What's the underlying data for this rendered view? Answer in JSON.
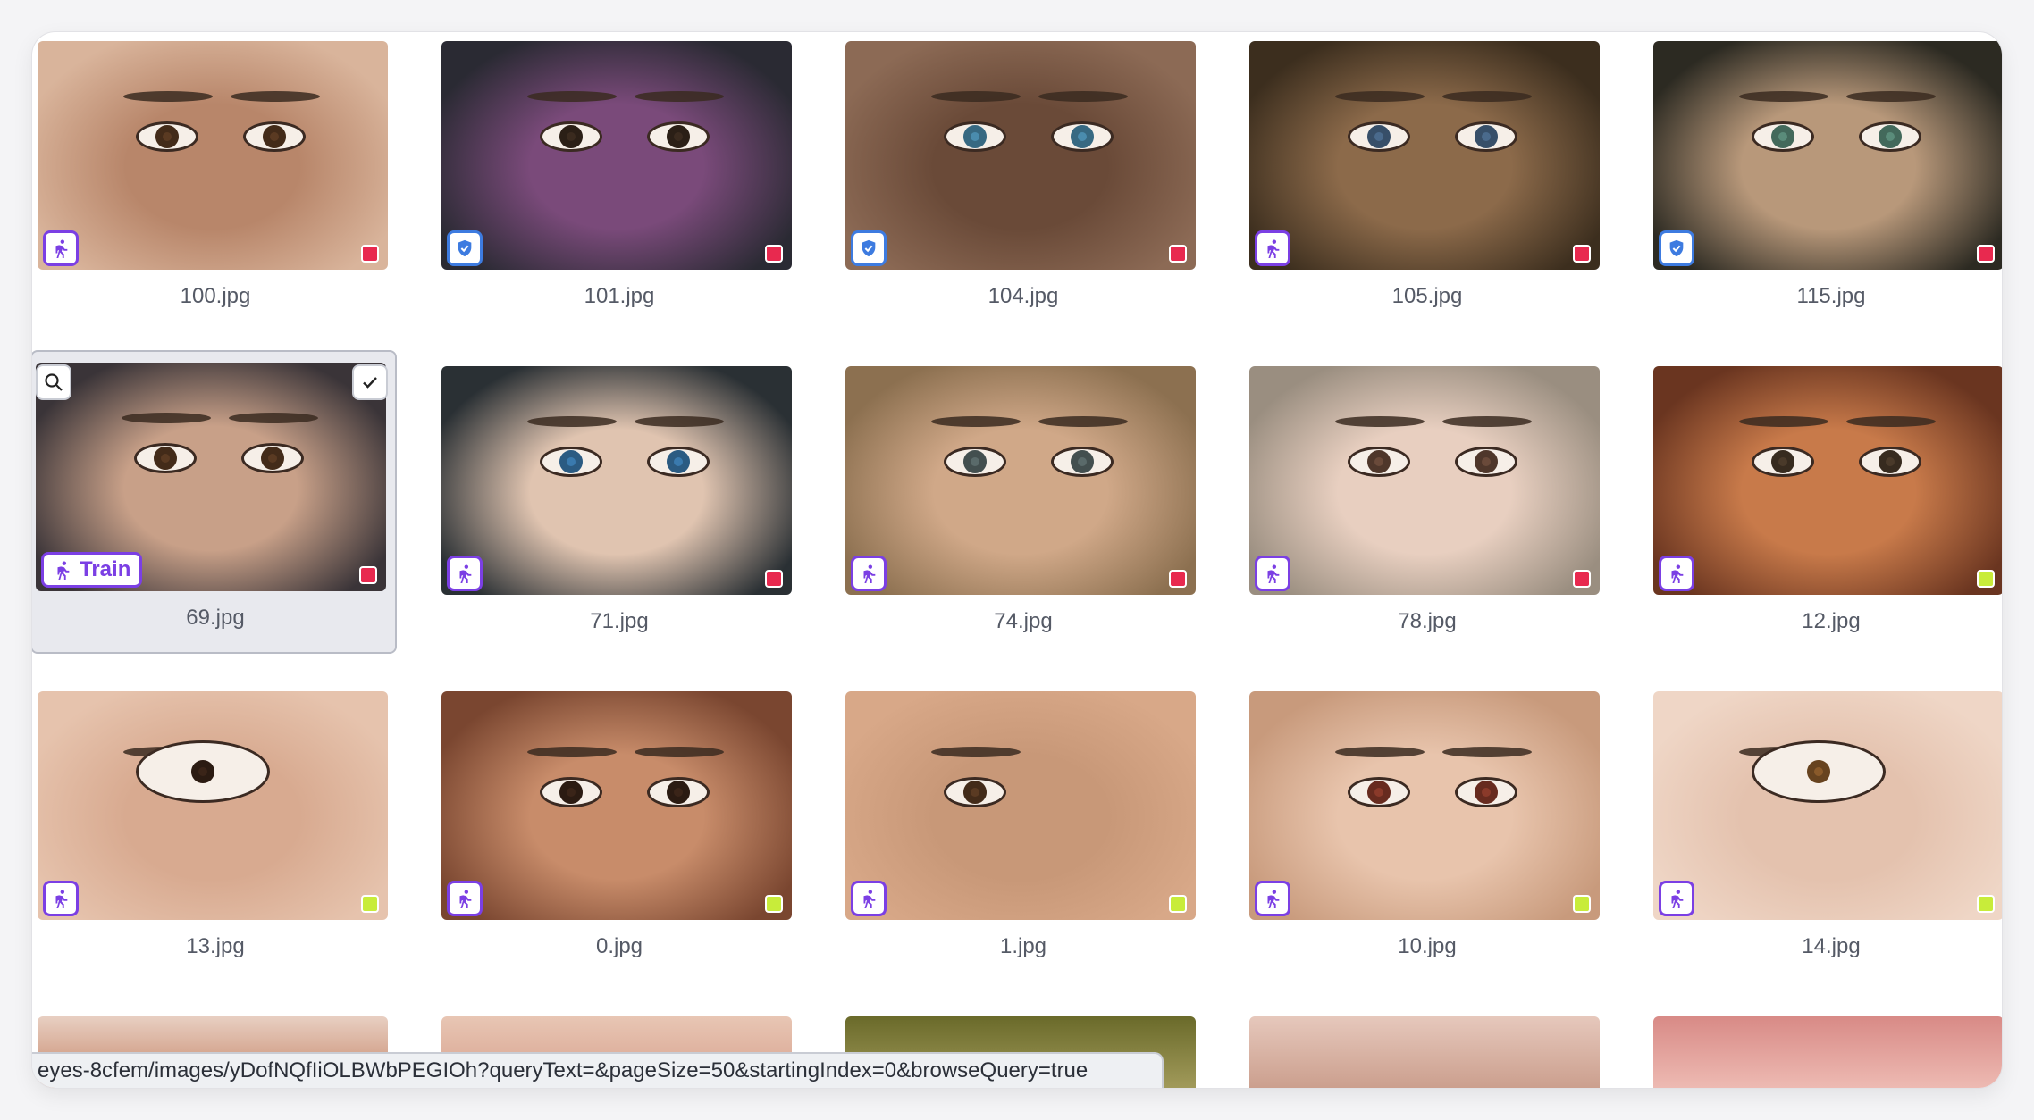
{
  "colors": {
    "accent": "#7b3fe4",
    "shield": "#3d7be0",
    "tag_red": "#e8294f",
    "tag_green": "#c8ec3a"
  },
  "rows": [
    [
      {
        "name": "100.jpg",
        "badge": "runner-icon",
        "tag": "red"
      },
      {
        "name": "101.jpg",
        "badge": "shield-icon",
        "tag": "red"
      },
      {
        "name": "104.jpg",
        "badge": "shield-icon",
        "tag": "red"
      },
      {
        "name": "105.jpg",
        "badge": "runner-icon",
        "tag": "red"
      },
      {
        "name": "115.jpg",
        "badge": "shield-icon",
        "tag": "red"
      }
    ],
    [
      {
        "name": "69.jpg",
        "badge": "runner-icon",
        "badge_text": "Train",
        "tag": "red",
        "selected": true
      },
      {
        "name": "71.jpg",
        "badge": "runner-icon",
        "tag": "red"
      },
      {
        "name": "74.jpg",
        "badge": "runner-icon",
        "tag": "red"
      },
      {
        "name": "78.jpg",
        "badge": "runner-icon",
        "tag": "red"
      },
      {
        "name": "12.jpg",
        "badge": "runner-icon",
        "tag": "green"
      }
    ],
    [
      {
        "name": "13.jpg",
        "badge": "runner-icon",
        "tag": "green"
      },
      {
        "name": "0.jpg",
        "badge": "runner-icon",
        "tag": "green"
      },
      {
        "name": "1.jpg",
        "badge": "runner-icon",
        "tag": "green"
      },
      {
        "name": "10.jpg",
        "badge": "runner-icon",
        "tag": "green"
      },
      {
        "name": "14.jpg",
        "badge": "runner-icon",
        "tag": "green"
      }
    ]
  ],
  "status_url": "eyes-8cfem/images/yDofNQfIiOLBWbPEGIOh?queryText=&pageSize=50&startingIndex=0&browseQuery=true"
}
